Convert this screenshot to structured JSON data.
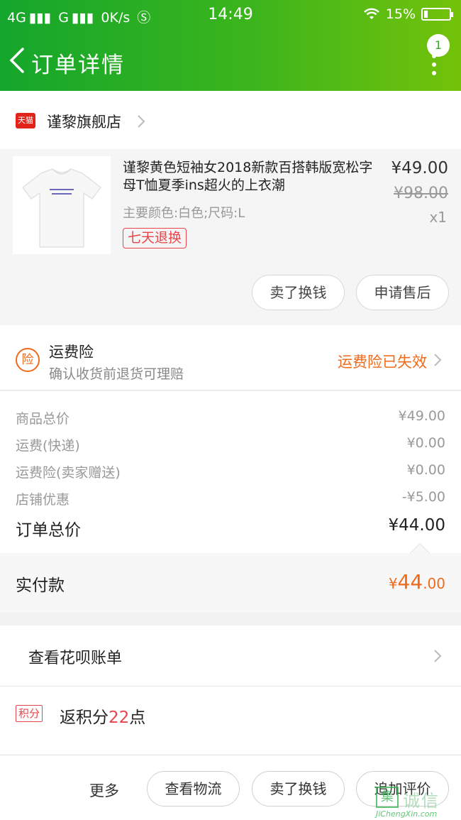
{
  "status_bar": {
    "network1": "4G",
    "network2": "G",
    "speed": "0K/s",
    "time": "14:49",
    "battery_percent": "15%",
    "battery_level": 0.15
  },
  "header": {
    "title": "订单详情",
    "notification_count": "1"
  },
  "store": {
    "badge": "天猫",
    "name": "谨黎旗舰店"
  },
  "product": {
    "name": "谨黎黄色短袖女2018新款百搭韩版宽松字母T恤夏季ins超火的上衣潮",
    "spec": "主要颜色:白色;尺码:L",
    "return_policy": "七天退换",
    "price": "¥49.00",
    "original_price": "¥98.00",
    "quantity": "x1",
    "sell_button": "卖了换钱",
    "after_sale_button": "申请售后"
  },
  "insurance": {
    "icon_label": "险",
    "title": "运费险",
    "subtitle": "确认收货前退货可理赔",
    "status": "运费险已失效"
  },
  "price_rows": [
    {
      "label": "商品总价",
      "value": "¥49.00"
    },
    {
      "label": "运费(快递)",
      "value": "¥0.00"
    },
    {
      "label": "运费险(卖家赠送)",
      "value": "¥0.00"
    },
    {
      "label": "店铺优惠",
      "value": "-¥5.00"
    }
  ],
  "order_total": {
    "label": "订单总价",
    "value": "¥44.00"
  },
  "paid": {
    "label": "实付款",
    "currency": "¥",
    "integer": "44",
    "decimal": ".00"
  },
  "huabei": {
    "label": "查看花呗账单"
  },
  "points": {
    "tag": "积分",
    "prefix": "返积分",
    "number": "22",
    "suffix": "点"
  },
  "bottom_bar": {
    "more": "更多",
    "logistics_button": "查看物流",
    "sell_button": "卖了换钱",
    "review_button": "追加评价"
  },
  "watermark": {
    "box": "集",
    "cn": "诚信",
    "en": "JiChengXin.com"
  },
  "colors": {
    "header_green": "#3cb51c",
    "accent_orange": "#ef6a1b",
    "accent_red": "#e8454b"
  },
  "icons": {
    "back": "chevron-left-icon",
    "more": "more-vertical-icon",
    "store": "tmall-icon",
    "insurance": "insurance-icon",
    "points": "points-icon",
    "chevron": "chevron-right-icon"
  }
}
